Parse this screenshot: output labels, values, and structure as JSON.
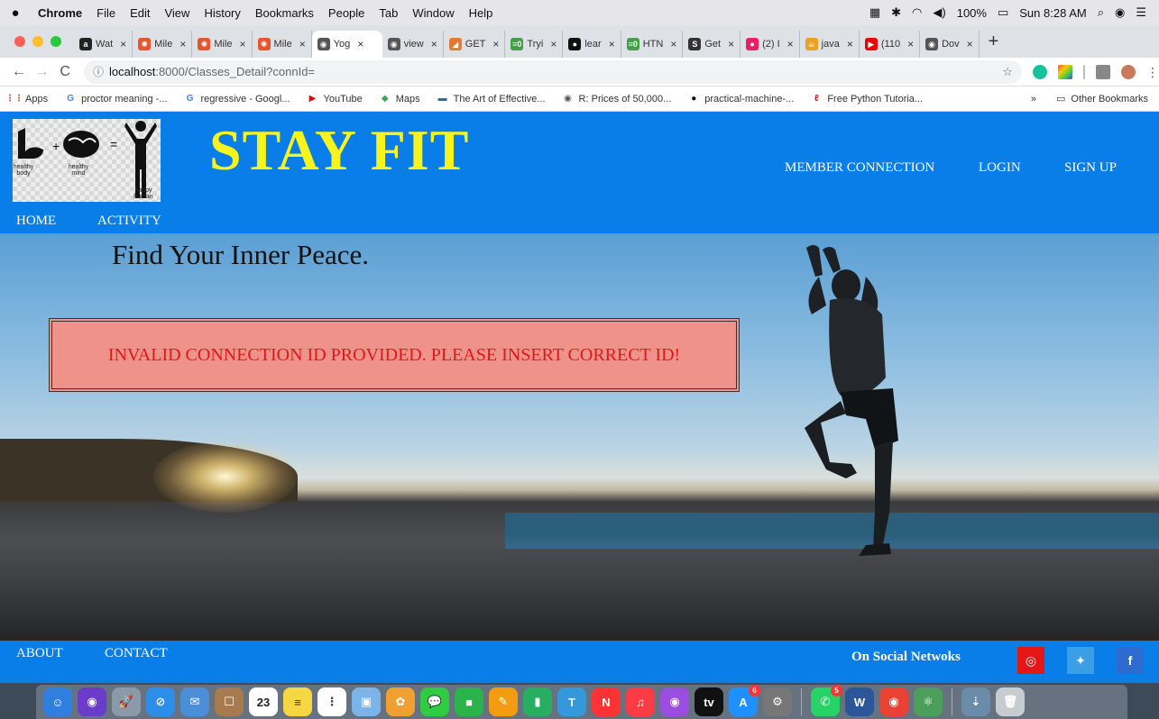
{
  "menubar": {
    "app": "Chrome",
    "menus": [
      "File",
      "Edit",
      "View",
      "History",
      "Bookmarks",
      "People",
      "Tab",
      "Window",
      "Help"
    ],
    "battery": "100%",
    "clock": "Sun 8:28 AM"
  },
  "tabs": [
    {
      "label": "Wat",
      "color": "#222",
      "glyph": "a"
    },
    {
      "label": "Mile",
      "color": "#e8552b",
      "glyph": "✺"
    },
    {
      "label": "Mile",
      "color": "#e8552b",
      "glyph": "✺"
    },
    {
      "label": "Mile",
      "color": "#e8552b",
      "glyph": "✺"
    },
    {
      "label": "Yog",
      "color": "#555",
      "glyph": "◉",
      "active": true
    },
    {
      "label": "view",
      "color": "#555",
      "glyph": "◉"
    },
    {
      "label": "GET",
      "color": "#e37a2d",
      "glyph": "◢"
    },
    {
      "label": "Tryi",
      "color": "#43a047",
      "glyph": "=0"
    },
    {
      "label": "lear",
      "color": "#111",
      "glyph": "●"
    },
    {
      "label": "HTN",
      "color": "#43a047",
      "glyph": "=0"
    },
    {
      "label": "Get",
      "color": "#333",
      "glyph": "S"
    },
    {
      "label": "(2) I",
      "color": "#e91e63",
      "glyph": "●"
    },
    {
      "label": "java",
      "color": "#f0a020",
      "glyph": "☕"
    },
    {
      "label": "(110",
      "color": "#e00",
      "glyph": "▶"
    },
    {
      "label": "Dov",
      "color": "#555",
      "glyph": "◉"
    }
  ],
  "address": {
    "host": "localhost",
    "path": ":8000/Classes_Detail?connId="
  },
  "bookmarks": [
    {
      "label": "Apps",
      "icon": "apps-icon",
      "color": "#e94235",
      "glyph": "⋮⋮"
    },
    {
      "label": "proctor meaning -...",
      "icon": "google-icon",
      "color": "#4285f4",
      "glyph": "G"
    },
    {
      "label": "regressive - Googl...",
      "icon": "google-icon",
      "color": "#4285f4",
      "glyph": "G"
    },
    {
      "label": "YouTube",
      "icon": "youtube-icon",
      "color": "#e00",
      "glyph": "▶"
    },
    {
      "label": "Maps",
      "icon": "maps-icon",
      "color": "#34a853",
      "glyph": "◆"
    },
    {
      "label": "The Art of Effective...",
      "icon": "book-icon",
      "color": "#2a6f9c",
      "glyph": "▬"
    },
    {
      "label": "R: Prices of 50,000...",
      "icon": "globe-icon",
      "color": "#555",
      "glyph": "◉"
    },
    {
      "label": "practical-machine-...",
      "icon": "github-icon",
      "color": "#111",
      "glyph": "●"
    },
    {
      "label": "Free Python Tutoria...",
      "icon": "python-icon",
      "color": "#c62828",
      "glyph": "ℓ"
    }
  ],
  "bookmarks_other": "Other Bookmarks",
  "bookmarks_more": "»",
  "site": {
    "title": "STAY FIT",
    "logo_labels": {
      "body": "healthy body",
      "mind": "healthy mind",
      "human": "happy human"
    },
    "nav_right": [
      "MEMBER CONNECTION",
      "LOGIN",
      "SIGN UP"
    ],
    "nav_left": [
      "HOME",
      "ACTIVITY"
    ],
    "tagline": "Find Your Inner Peace.",
    "alert": "INVALID CONNECTION ID PROVIDED. PLEASE INSERT CORRECT ID!",
    "footer_links": [
      "ABOUT",
      "CONTACT"
    ],
    "social_label": "On Social Netwoks",
    "social": [
      {
        "name": "instagram",
        "color": "#e51616",
        "glyph": "◎"
      },
      {
        "name": "twitter",
        "color": "#3a9fe6",
        "glyph": "🐦"
      },
      {
        "name": "facebook",
        "color": "#2e6bd0",
        "glyph": "f"
      }
    ]
  },
  "dock": [
    {
      "name": "finder",
      "color": "#2f7fe0",
      "glyph": "☺"
    },
    {
      "name": "siri",
      "color": "#6a3cc9",
      "glyph": "◉"
    },
    {
      "name": "launchpad",
      "color": "#8a9aa8",
      "glyph": "🚀"
    },
    {
      "name": "safari",
      "color": "#2c8ee8",
      "glyph": "⊘"
    },
    {
      "name": "mail",
      "color": "#4a8fd8",
      "glyph": "✉"
    },
    {
      "name": "contacts",
      "color": "#a77b4d",
      "glyph": "☐"
    },
    {
      "name": "calendar",
      "color": "#fff",
      "glyph": "23",
      "text": "#222"
    },
    {
      "name": "notes",
      "color": "#f5d742",
      "glyph": "≡",
      "text": "#333"
    },
    {
      "name": "reminders",
      "color": "#fff",
      "glyph": "⋮",
      "text": "#444"
    },
    {
      "name": "preview",
      "color": "#7ab4e8",
      "glyph": "▣"
    },
    {
      "name": "photos",
      "color": "#f0a030",
      "glyph": "✿"
    },
    {
      "name": "messages",
      "color": "#2ecc40",
      "glyph": "💬"
    },
    {
      "name": "facetime",
      "color": "#29b34a",
      "glyph": "■"
    },
    {
      "name": "pages",
      "color": "#f39c12",
      "glyph": "✎"
    },
    {
      "name": "numbers",
      "color": "#27ae60",
      "glyph": "▮"
    },
    {
      "name": "keynote",
      "color": "#3498db",
      "glyph": "T"
    },
    {
      "name": "news",
      "color": "#f33",
      "glyph": "N"
    },
    {
      "name": "music",
      "color": "#fc3c44",
      "glyph": "♫"
    },
    {
      "name": "podcasts",
      "color": "#9b4de0",
      "glyph": "◉"
    },
    {
      "name": "tv",
      "color": "#111",
      "glyph": "tv"
    },
    {
      "name": "app-store",
      "color": "#1e90ff",
      "glyph": "A",
      "badge": "6"
    },
    {
      "name": "system-preferences",
      "color": "#777",
      "glyph": "⚙"
    },
    {
      "name": "whatsapp",
      "color": "#25d366",
      "glyph": "✆",
      "badge": "5",
      "sep_before": true
    },
    {
      "name": "word",
      "color": "#2b579a",
      "glyph": "W"
    },
    {
      "name": "chrome",
      "color": "#e94235",
      "glyph": "◉"
    },
    {
      "name": "atom",
      "color": "#4b9f5a",
      "glyph": "⚛"
    },
    {
      "name": "downloads",
      "color": "#6a8ca8",
      "glyph": "⇣",
      "sep_before": true
    },
    {
      "name": "trash",
      "color": "#c7ccd1",
      "glyph": "🗑"
    }
  ]
}
